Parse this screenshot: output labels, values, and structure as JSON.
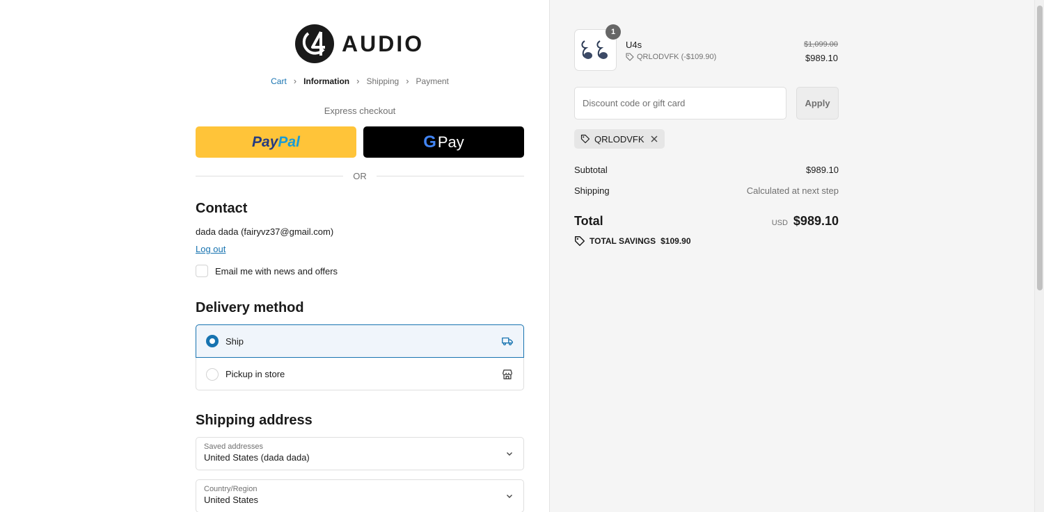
{
  "brand": {
    "name": "AUDIO"
  },
  "breadcrumb": {
    "cart": "Cart",
    "information": "Information",
    "shipping": "Shipping",
    "payment": "Payment"
  },
  "express": {
    "label": "Express checkout",
    "paypal_a": "Pay",
    "paypal_b": "Pal",
    "gpay_g": "G",
    "gpay_pay": "Pay",
    "or": "OR"
  },
  "contact": {
    "title": "Contact",
    "user": "dada dada (fairyvz37@gmail.com)",
    "logout": "Log out",
    "newsletter_label": "Email me with news and offers"
  },
  "delivery": {
    "title": "Delivery method",
    "options": [
      {
        "label": "Ship",
        "selected": true,
        "icon": "truck-icon"
      },
      {
        "label": "Pickup in store",
        "selected": false,
        "icon": "store-icon"
      }
    ]
  },
  "shipping_address": {
    "title": "Shipping address",
    "saved_label": "Saved addresses",
    "saved_value": "United States (dada dada)",
    "country_label": "Country/Region",
    "country_value": "United States"
  },
  "order": {
    "item": {
      "quantity": "1",
      "name": "U4s",
      "discount": "QRLODVFK (-$109.90)",
      "original_price": "$1,099.00",
      "price": "$989.10"
    },
    "discount_placeholder": "Discount code or gift card",
    "apply_label": "Apply",
    "applied_code": "QRLODVFK",
    "subtotal_label": "Subtotal",
    "subtotal_value": "$989.10",
    "shipping_label": "Shipping",
    "shipping_value": "Calculated at next step",
    "total_label": "Total",
    "currency": "USD",
    "total_value": "$989.10",
    "savings_label": "TOTAL SAVINGS",
    "savings_value": "$109.90"
  },
  "colors": {
    "accent": "#1773b0",
    "paypal": "#ffc439",
    "gpay": "#000000",
    "summary_bg": "#f5f5f5"
  }
}
